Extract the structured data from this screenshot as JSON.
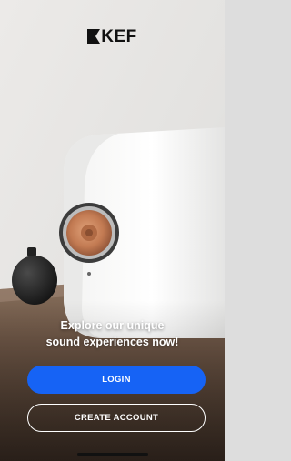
{
  "app": {
    "brand": "KEF",
    "accent_color": "#1663f5"
  },
  "welcome": {
    "tagline_line1": "Explore our unique",
    "tagline_line2": "sound experiences now!"
  },
  "actions": {
    "login_label": "LOGIN",
    "create_account_label": "CREATE ACCOUNT"
  }
}
